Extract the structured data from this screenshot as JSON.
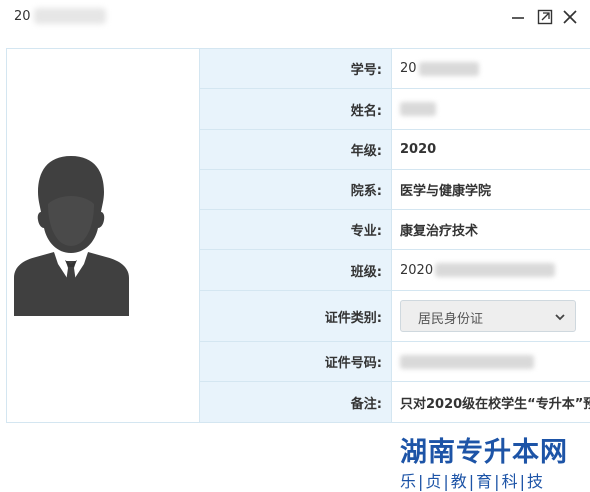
{
  "window": {
    "title_visible": "20"
  },
  "fields": [
    {
      "label": "学号:",
      "value": "20"
    },
    {
      "label": "姓名:",
      "value": ""
    },
    {
      "label": "年级:",
      "value": "2020"
    },
    {
      "label": "院系:",
      "value": "医学与健康学院"
    },
    {
      "label": "专业:",
      "value": "康复治疗技术"
    },
    {
      "label": "班级:",
      "value": "2020"
    },
    {
      "label": "证件类别:",
      "value": "居民身份证"
    },
    {
      "label": "证件号码:",
      "value": ""
    },
    {
      "label": "备注:",
      "value": "只对2020级在校学生“专升本”预"
    }
  ],
  "watermark": {
    "title": "湖南专升本网",
    "subtitle": "乐|贞|教|育|科|技"
  },
  "colors": {
    "label_bg": "#e8f3fb",
    "border": "#d4e6f1",
    "watermark": "#1d54a7",
    "avatar": "#404040"
  },
  "icons": {
    "minimize": "minimize-icon",
    "maximize": "maximize-icon",
    "close": "close-icon",
    "avatar": "user-silhouette-icon",
    "dropdown": "chevron-down-icon"
  }
}
